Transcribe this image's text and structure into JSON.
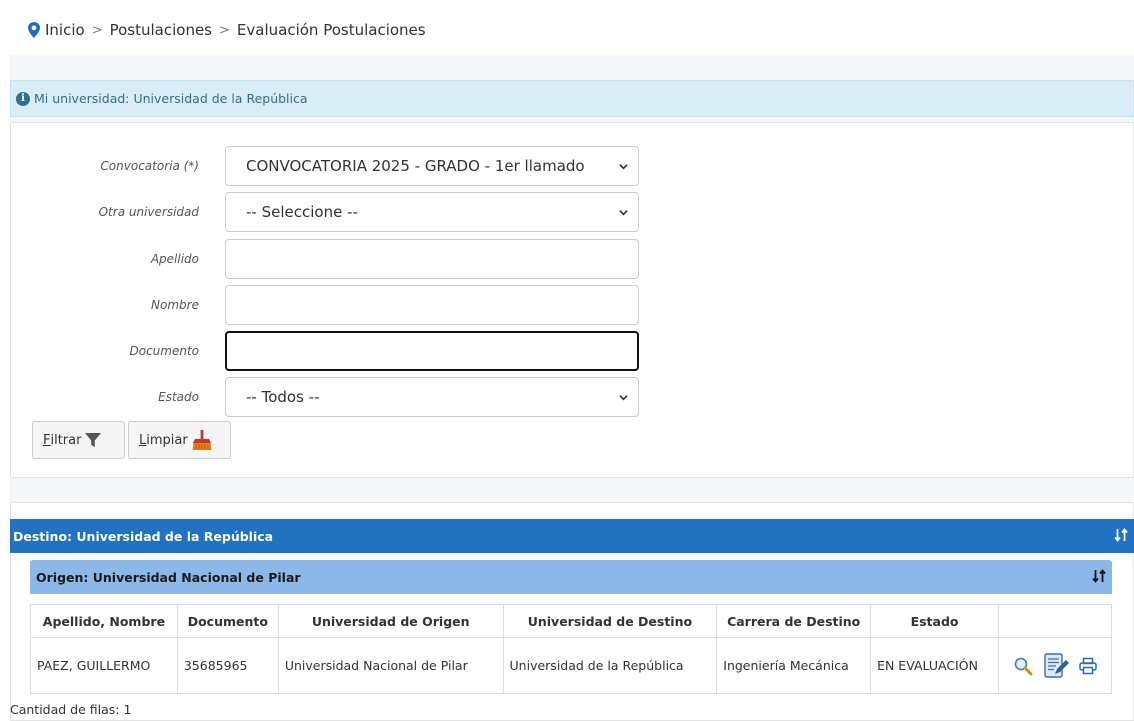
{
  "breadcrumb": {
    "items": [
      "Inicio",
      "Postulaciones",
      "Evaluación Postulaciones"
    ],
    "separator": ">"
  },
  "info": {
    "text": "Mi universidad: Universidad de la República"
  },
  "filter": {
    "convocatoria": {
      "label": "Convocatoria (*)",
      "value": "CONVOCATORIA 2025 - GRADO - 1er llamado"
    },
    "otra_universidad": {
      "label": "Otra universidad",
      "value": "-- Seleccione --"
    },
    "apellido": {
      "label": "Apellido",
      "value": ""
    },
    "nombre": {
      "label": "Nombre",
      "value": ""
    },
    "documento": {
      "label": "Documento",
      "value": ""
    },
    "estado": {
      "label": "Estado",
      "value": "-- Todos --"
    },
    "filtrar_first": "F",
    "filtrar_rest": "iltrar",
    "limpiar_first": "L",
    "limpiar_rest": "impiar"
  },
  "results": {
    "destino_title": "Destino: Universidad de la República",
    "origen_title": "Origen: Universidad Nacional de Pilar",
    "columns": [
      "Apellido, Nombre",
      "Documento",
      "Universidad de Origen",
      "Universidad de Destino",
      "Carrera de Destino",
      "Estado",
      ""
    ],
    "rows": [
      [
        "PAEZ, GUILLERMO",
        "35685965",
        "Universidad Nacional de Pilar",
        "Universidad de la República",
        "Ingeniería Mecánica",
        "EN EVALUACIÓN"
      ]
    ],
    "count_text": "Cantidad de filas: 1"
  },
  "colors": {
    "destino_bar": "#2173c2",
    "origen_bar": "#8bb8e8",
    "info_bg": "#d9edf7"
  }
}
